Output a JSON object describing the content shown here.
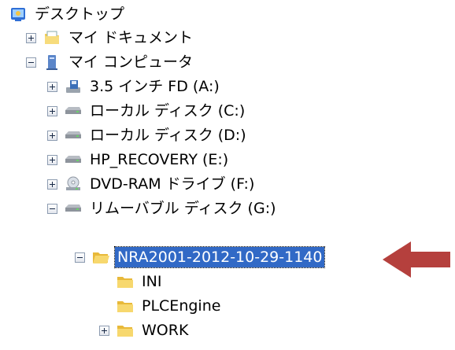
{
  "tree": {
    "desktop": "デスクトップ",
    "my_documents": "マイ ドキュメント",
    "my_computer": "マイ コンピュータ",
    "floppy": "3.5 インチ FD (A:)",
    "local_c": "ローカル ディスク (C:)",
    "local_d": "ローカル ディスク (D:)",
    "hp_recovery": "HP_RECOVERY (E:)",
    "dvd": "DVD-RAM ドライブ (F:)",
    "removable": "リムーバブル ディスク (G:)",
    "nra_folder": "NRA2001-2012-10-29-1140",
    "ini": "INI",
    "plcengine": "PLCEngine",
    "work": "WORK"
  },
  "icons": {
    "desktop": "desktop-icon",
    "my_documents": "folder-docs-icon",
    "my_computer": "computer-icon",
    "floppy": "floppy-drive-icon",
    "disk": "hard-disk-icon",
    "dvd": "dvd-drive-icon",
    "folder": "folder-icon",
    "arrow": "pointer-arrow-icon"
  },
  "colors": {
    "selection": "#3169c6",
    "arrow": "#b5403d"
  }
}
